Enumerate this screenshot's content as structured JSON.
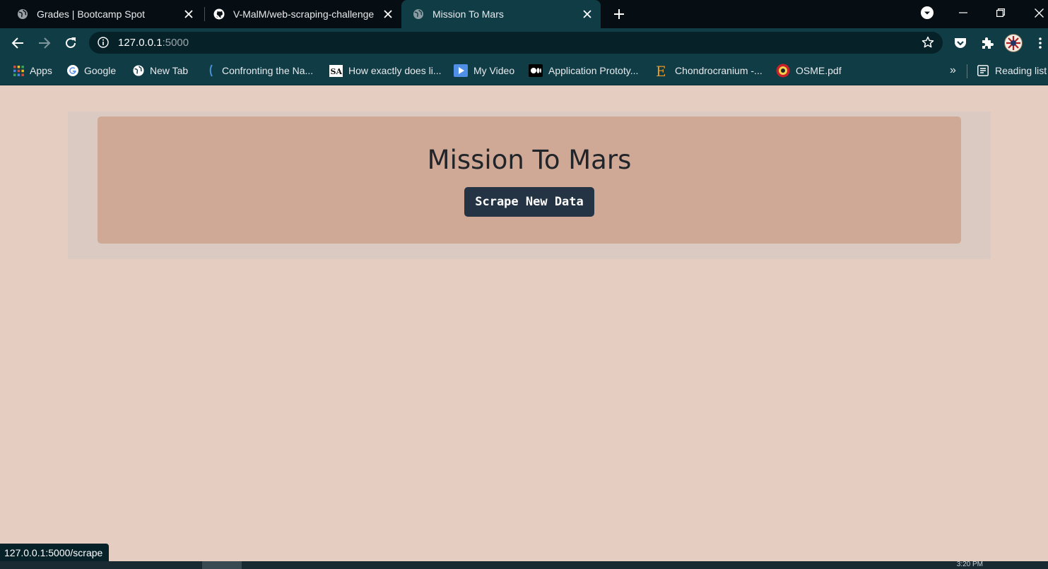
{
  "browser": {
    "tabs": [
      {
        "title": "Grades | Bootcamp Spot",
        "favicon": "globe-icon",
        "active": false
      },
      {
        "title": "V-MalM/web-scraping-challenge",
        "favicon": "github-icon",
        "active": false
      },
      {
        "title": "Mission To Mars",
        "favicon": "globe-icon",
        "active": true
      }
    ],
    "address": {
      "host": "127.0.0.1",
      "port": ":5000"
    },
    "bookmarks": [
      {
        "label": "Apps",
        "icon": "apps-grid-icon"
      },
      {
        "label": "Google",
        "icon": "google-icon"
      },
      {
        "label": "New Tab",
        "icon": "globe-icon"
      },
      {
        "label": "Confronting the Na...",
        "icon": "bookmark-site-icon"
      },
      {
        "label": "How exactly does li...",
        "icon": "sa-icon"
      },
      {
        "label": "My Video",
        "icon": "video-icon"
      },
      {
        "label": "Application Prototy...",
        "icon": "medium-icon"
      },
      {
        "label": "Chondrocranium -...",
        "icon": "e-letter-icon"
      },
      {
        "label": "OSME.pdf",
        "icon": "seal-icon"
      }
    ],
    "overflow_label": "»",
    "reading_list": "Reading list",
    "status_url": "127.0.0.1:5000/scrape"
  },
  "page": {
    "heading": "Mission To Mars",
    "scrape_button": "Scrape New Data"
  },
  "taskbar": {
    "clock": "3:20 PM"
  },
  "colors": {
    "tabstrip": "#060e13",
    "toolbar": "#103c45",
    "page_bg": "#e6cdc2",
    "jumbotron": "#cfa996",
    "button": "#243444"
  }
}
